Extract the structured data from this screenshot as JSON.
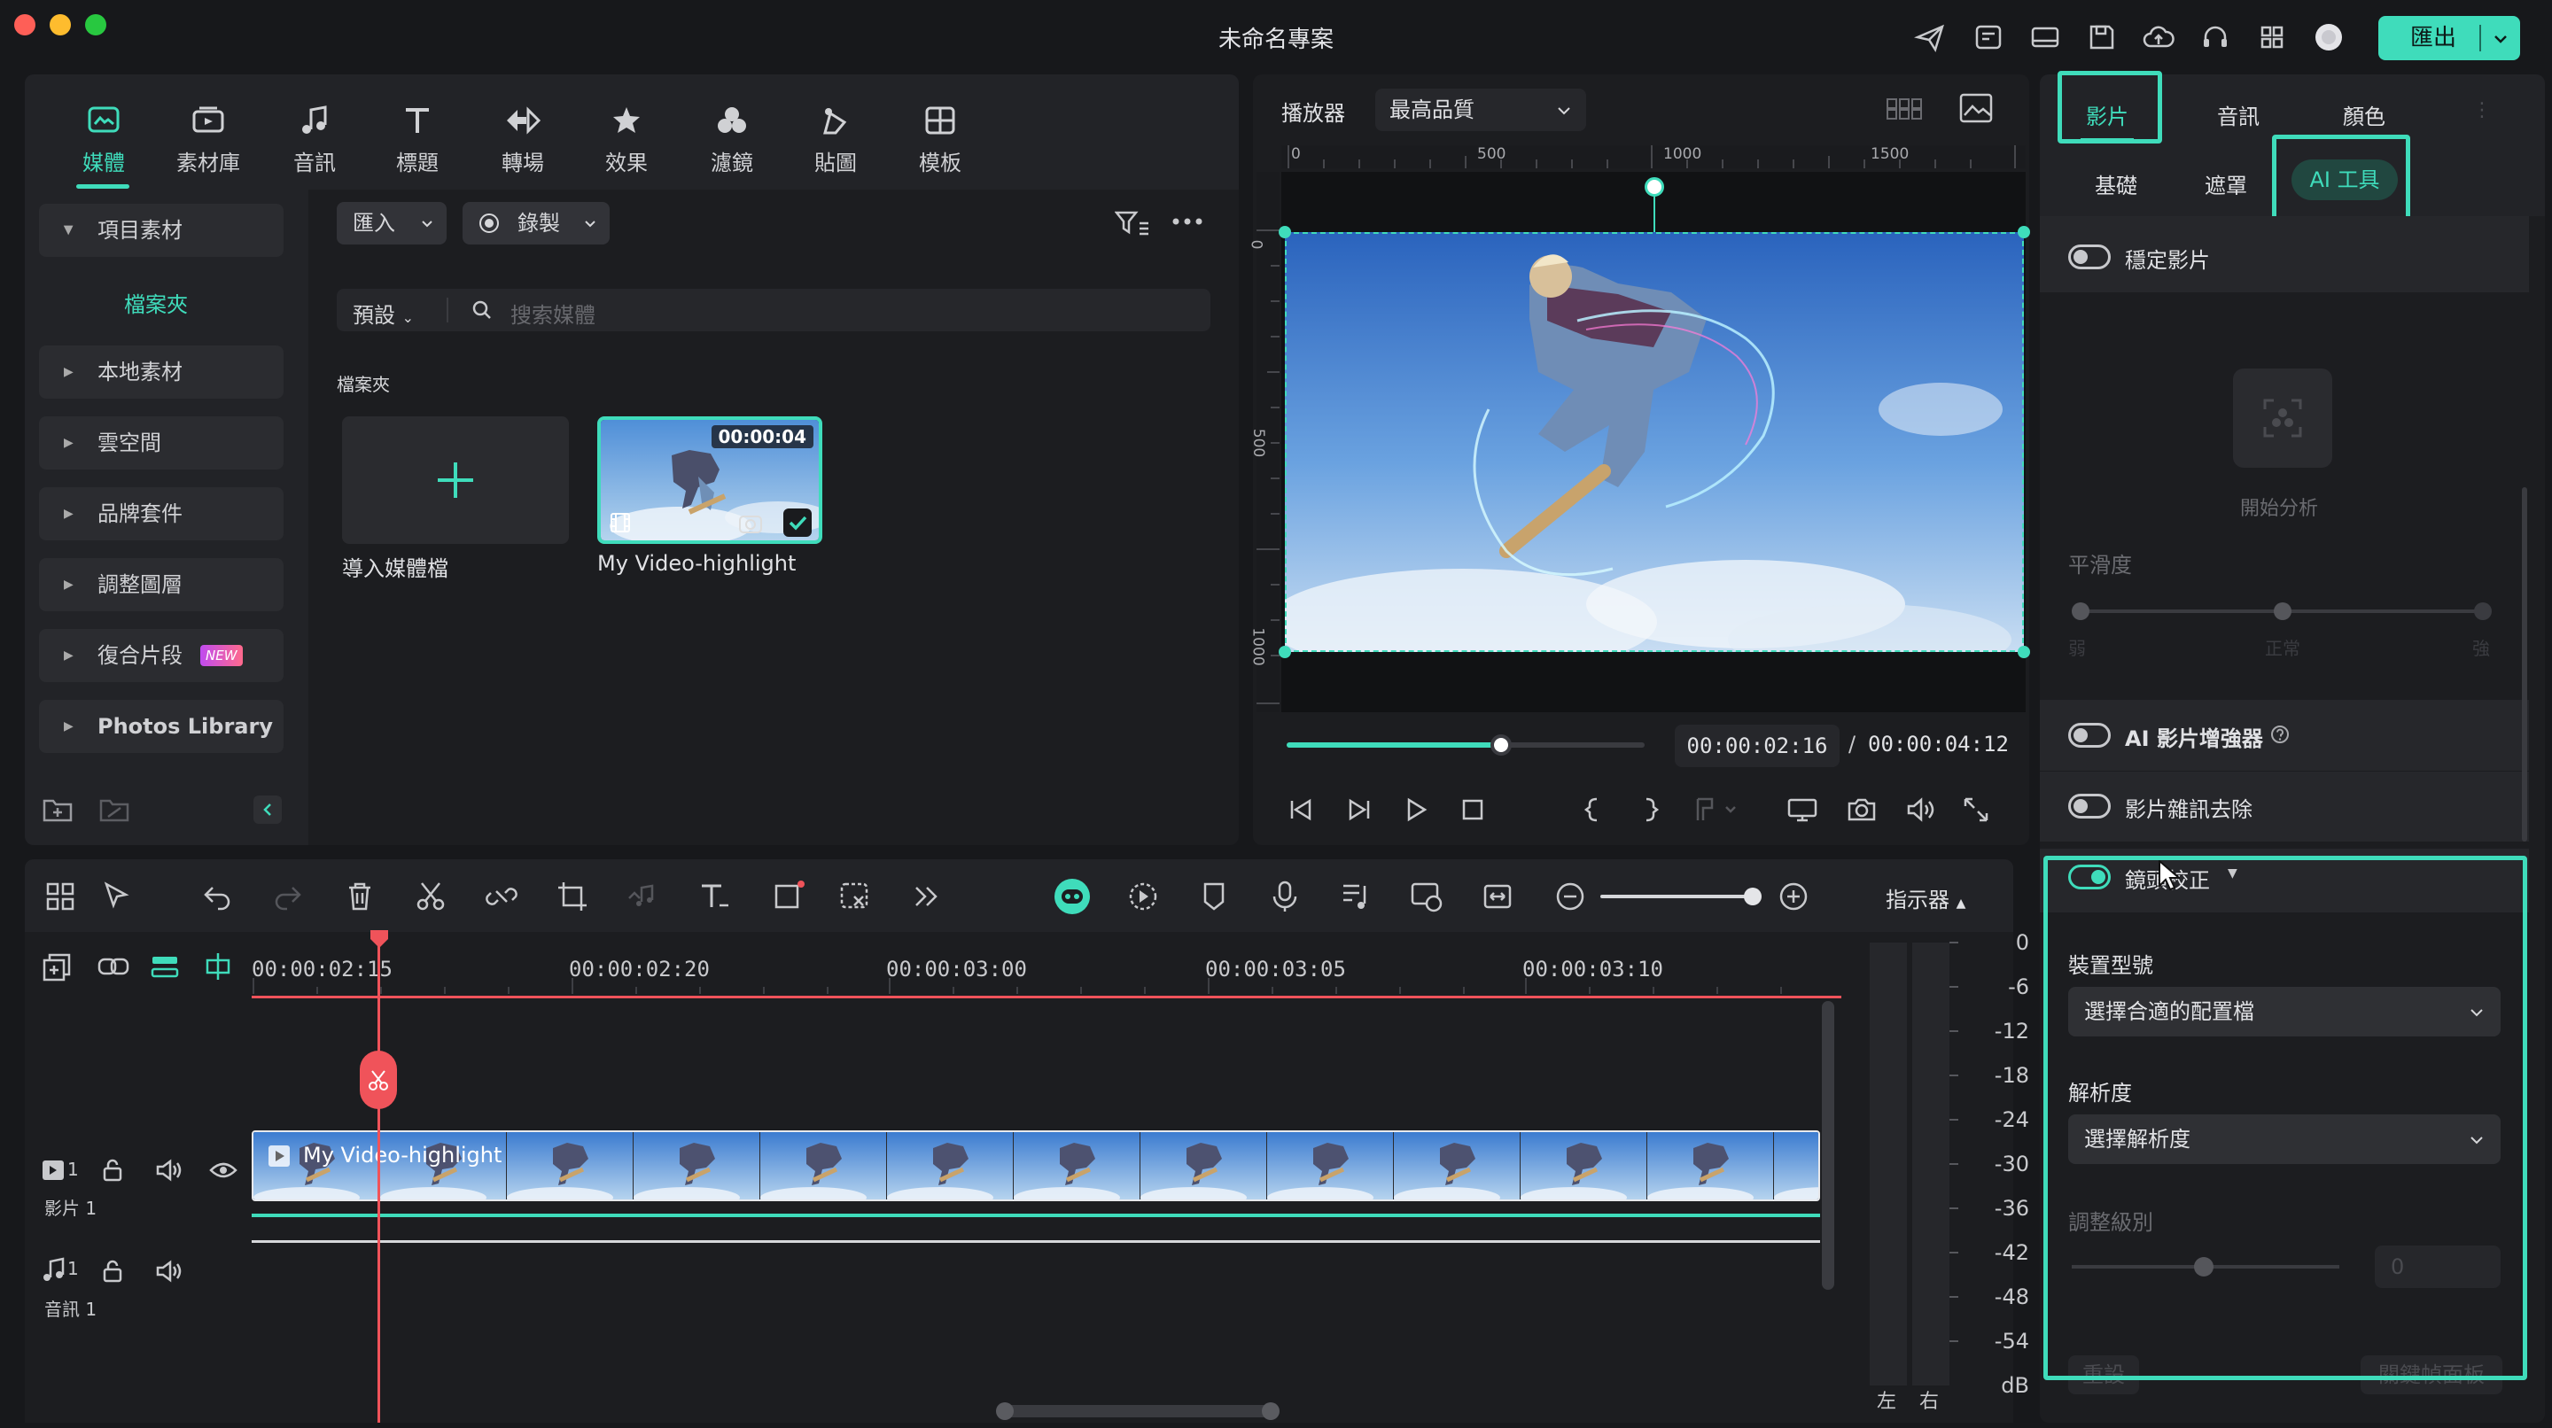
{
  "window": {
    "title": "未命名專案",
    "export_label": "匯出"
  },
  "media_tabs": [
    {
      "label": "媒體",
      "icon": "media-icon"
    },
    {
      "label": "素材庫",
      "icon": "library-icon"
    },
    {
      "label": "音訊",
      "icon": "music-icon"
    },
    {
      "label": "標題",
      "icon": "title-icon"
    },
    {
      "label": "轉場",
      "icon": "transition-icon"
    },
    {
      "label": "效果",
      "icon": "effects-icon"
    },
    {
      "label": "濾鏡",
      "icon": "filter-icon"
    },
    {
      "label": "貼圖",
      "icon": "sticker-icon"
    },
    {
      "label": "模板",
      "icon": "template-icon"
    }
  ],
  "sidebar": {
    "project_media": "項目素材",
    "folder": "檔案夾",
    "items": [
      "本地素材",
      "雲空間",
      "品牌套件",
      "調整圖層",
      "復合片段",
      "Photos Library"
    ],
    "new_badge": "NEW"
  },
  "media": {
    "import_label": "匯入",
    "record_label": "錄製",
    "preset_label": "預設",
    "search_placeholder": "搜索媒體",
    "folder_heading": "檔案夾",
    "import_card_label": "導入媒體檔",
    "clip_name": "My Video-highlight",
    "clip_duration": "00:00:04"
  },
  "player": {
    "label": "播放器",
    "quality": "最高品質",
    "ruler_top": [
      "0",
      "500",
      "1000",
      "1500"
    ],
    "ruler_left": [
      "0",
      "500",
      "1000"
    ],
    "current_time": "00:00:02:16",
    "separator": "/",
    "total_time": "00:00:04:12",
    "progress": 0.6
  },
  "timeline": {
    "timecodes": [
      "00:00:02:15",
      "00:00:02:20",
      "00:00:03:00",
      "00:00:03:05",
      "00:00:03:10"
    ],
    "video_track_label": "影片 1",
    "video_track_num": "1",
    "audio_track_label": "音訊 1",
    "audio_track_num": "1",
    "clip_title": "My Video-highlight",
    "meter_label": "指示器",
    "db_scale": [
      "0",
      "-6",
      "-12",
      "-18",
      "-24",
      "-30",
      "-36",
      "-42",
      "-48",
      "-54",
      "dB"
    ],
    "left_label": "左",
    "right_label": "右"
  },
  "inspector": {
    "tabs": [
      "影片",
      "音訊",
      "顏色"
    ],
    "subtabs": [
      "基礎",
      "遮罩",
      "AI 工具"
    ],
    "stabilize_label": "穩定影片",
    "analyze_label": "開始分析",
    "smoothness_label": "平滑度",
    "smooth_scale": [
      "弱",
      "正常",
      "強"
    ],
    "ai_enhancer_label": "AI 影片增強器",
    "denoise_label": "影片雜訊去除",
    "lens_correction_label": "鏡頭校正",
    "device_model_label": "裝置型號",
    "device_model_value": "選擇合適的配置檔",
    "resolution_label": "解析度",
    "resolution_value": "選擇解析度",
    "adjust_level_label": "調整級別",
    "adjust_level_value": "0",
    "reset_label": "重設",
    "keyframe_label": "關鍵幀面板"
  },
  "colors": {
    "accent": "#3fdcbb",
    "playhead": "#f0535a",
    "background": "#17181b"
  }
}
